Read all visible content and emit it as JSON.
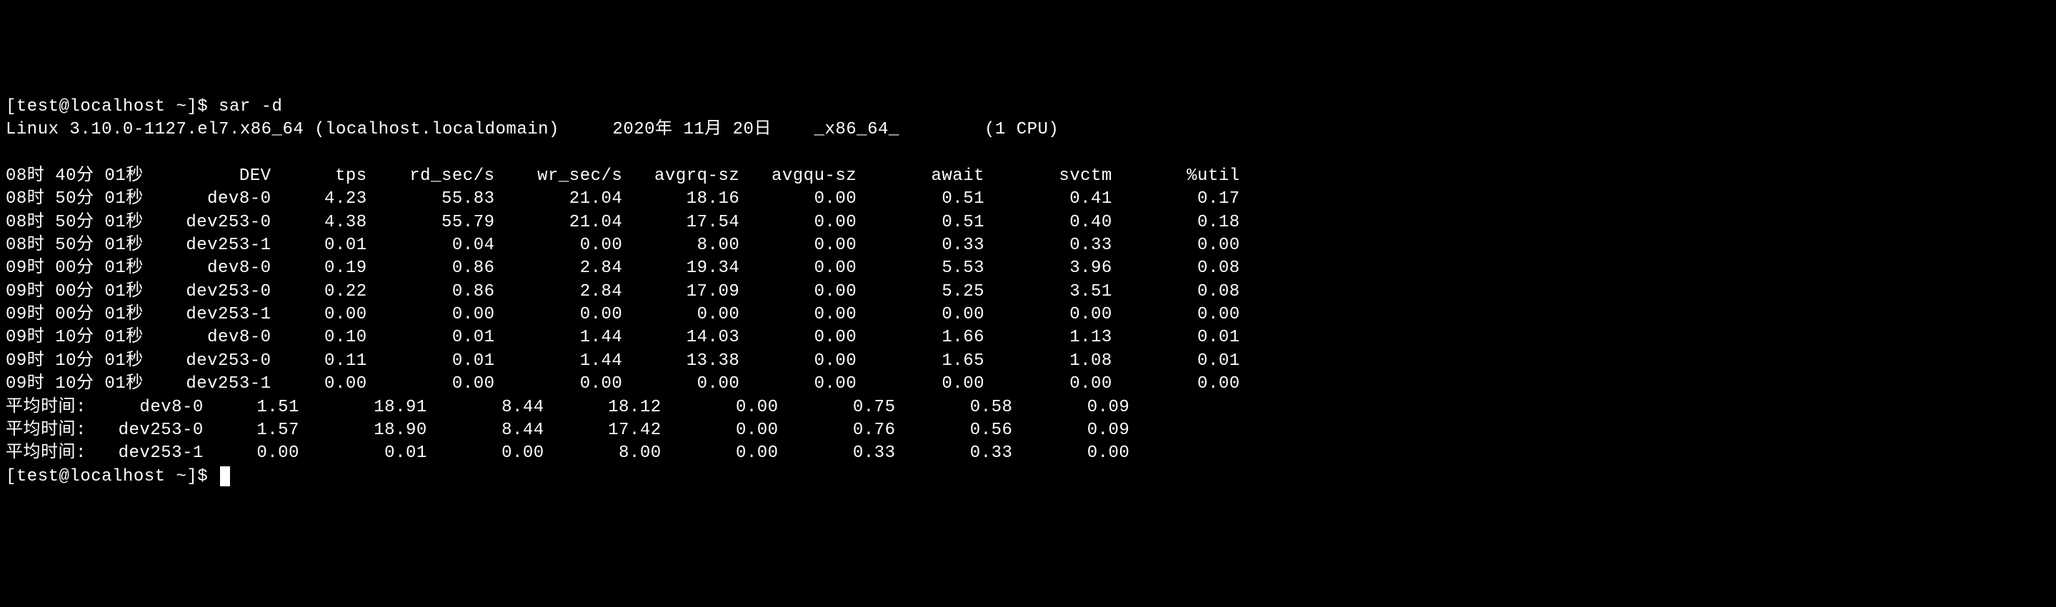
{
  "prompt1_prefix": "[test@localhost ~]$ ",
  "command": "sar -d",
  "sysline": "Linux 3.10.0-1127.el7.x86_64 (localhost.localdomain)     2020年 11月 20日    _x86_64_        (1 CPU)",
  "hdr_time": "08时 40分 01秒",
  "hdr_dev": "DEV",
  "headers": [
    "tps",
    "rd_sec/s",
    "wr_sec/s",
    "avgrq-sz",
    "avgqu-sz",
    "await",
    "svctm",
    "%util"
  ],
  "rows": [
    {
      "time": "08时 50分 01秒",
      "dev": "dev8-0",
      "v": [
        "4.23",
        "55.83",
        "21.04",
        "18.16",
        "0.00",
        "0.51",
        "0.41",
        "0.17"
      ]
    },
    {
      "time": "08时 50分 01秒",
      "dev": "dev253-0",
      "v": [
        "4.38",
        "55.79",
        "21.04",
        "17.54",
        "0.00",
        "0.51",
        "0.40",
        "0.18"
      ]
    },
    {
      "time": "08时 50分 01秒",
      "dev": "dev253-1",
      "v": [
        "0.01",
        "0.04",
        "0.00",
        "8.00",
        "0.00",
        "0.33",
        "0.33",
        "0.00"
      ]
    },
    {
      "time": "09时 00分 01秒",
      "dev": "dev8-0",
      "v": [
        "0.19",
        "0.86",
        "2.84",
        "19.34",
        "0.00",
        "5.53",
        "3.96",
        "0.08"
      ]
    },
    {
      "time": "09时 00分 01秒",
      "dev": "dev253-0",
      "v": [
        "0.22",
        "0.86",
        "2.84",
        "17.09",
        "0.00",
        "5.25",
        "3.51",
        "0.08"
      ]
    },
    {
      "time": "09时 00分 01秒",
      "dev": "dev253-1",
      "v": [
        "0.00",
        "0.00",
        "0.00",
        "0.00",
        "0.00",
        "0.00",
        "0.00",
        "0.00"
      ]
    },
    {
      "time": "09时 10分 01秒",
      "dev": "dev8-0",
      "v": [
        "0.10",
        "0.01",
        "1.44",
        "14.03",
        "0.00",
        "1.66",
        "1.13",
        "0.01"
      ]
    },
    {
      "time": "09时 10分 01秒",
      "dev": "dev253-0",
      "v": [
        "0.11",
        "0.01",
        "1.44",
        "13.38",
        "0.00",
        "1.65",
        "1.08",
        "0.01"
      ]
    },
    {
      "time": "09时 10分 01秒",
      "dev": "dev253-1",
      "v": [
        "0.00",
        "0.00",
        "0.00",
        "0.00",
        "0.00",
        "0.00",
        "0.00",
        "0.00"
      ]
    }
  ],
  "avg_label": "平均时间:",
  "avgrows": [
    {
      "dev": "dev8-0",
      "v": [
        "1.51",
        "18.91",
        "8.44",
        "18.12",
        "0.00",
        "0.75",
        "0.58",
        "0.09"
      ]
    },
    {
      "dev": "dev253-0",
      "v": [
        "1.57",
        "18.90",
        "8.44",
        "17.42",
        "0.00",
        "0.76",
        "0.56",
        "0.09"
      ]
    },
    {
      "dev": "dev253-1",
      "v": [
        "0.00",
        "0.01",
        "0.00",
        "8.00",
        "0.00",
        "0.33",
        "0.33",
        "0.00"
      ]
    }
  ],
  "prompt2": "[test@localhost ~]$ "
}
